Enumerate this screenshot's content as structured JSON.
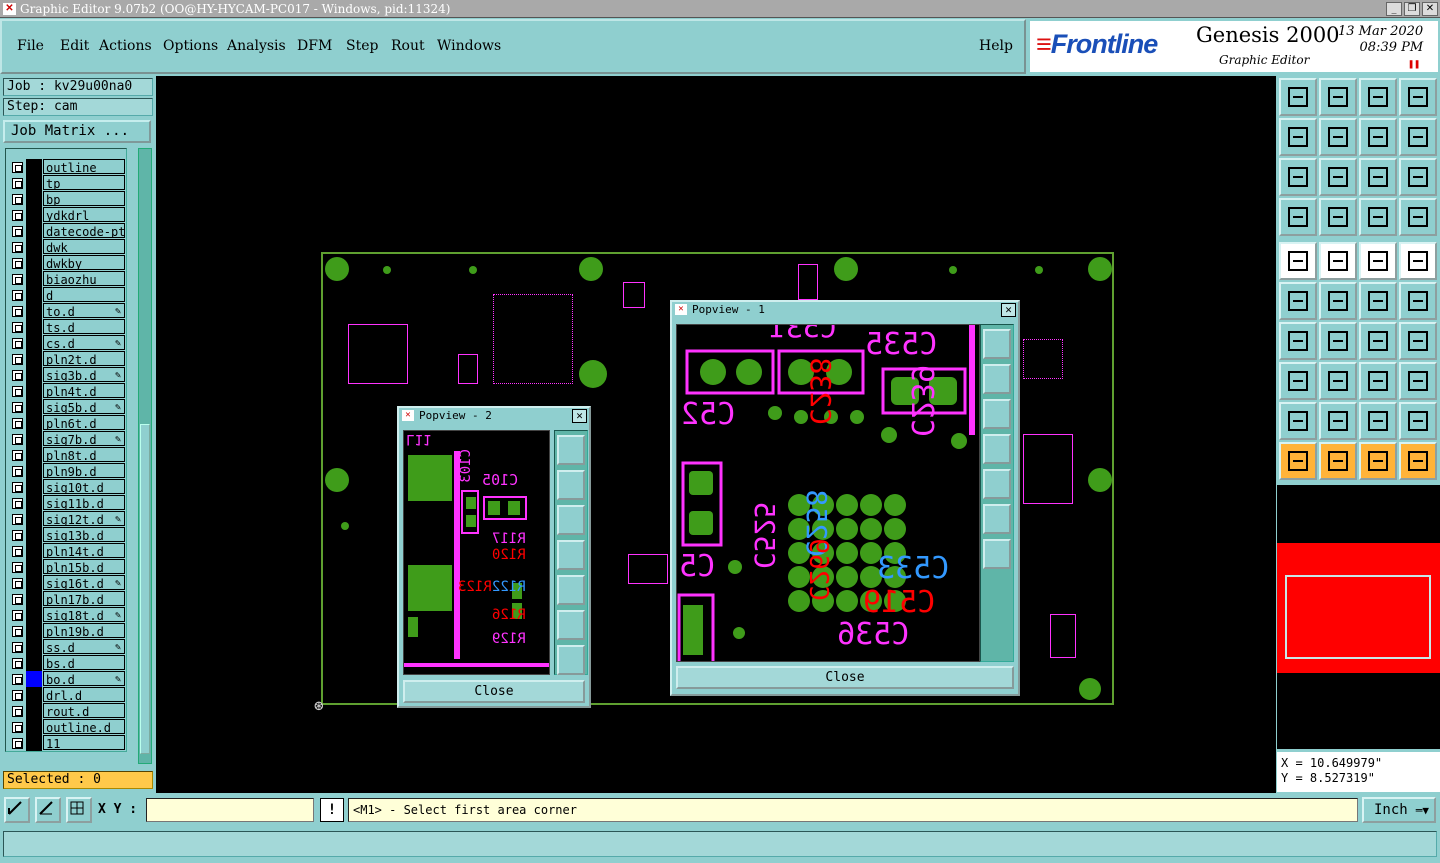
{
  "window": {
    "title": "Graphic Editor 9.07b2 (OO@HY-HYCAM-PC017 - Windows, pid:11324)"
  },
  "menu": {
    "file": "File",
    "edit": "Edit",
    "actions": "Actions",
    "options": "Options",
    "analysis": "Analysis",
    "dfm": "DFM",
    "step": "Step",
    "rout": "Rout",
    "windows": "Windows",
    "help": "Help"
  },
  "brand": {
    "logo": "Frontline",
    "product": "Genesis 2000",
    "subtitle": "Graphic Editor",
    "date": "13 Mar 2020",
    "time": "08:39 PM"
  },
  "job": {
    "job_label": "Job : kv29u00na0",
    "step_label": "Step: cam",
    "matrix_button": "Job Matrix ...",
    "selected": "Selected : 0"
  },
  "layers": [
    {
      "name": "outline"
    },
    {
      "name": "tp"
    },
    {
      "name": "bp"
    },
    {
      "name": "ydkdrl"
    },
    {
      "name": "datecode-ptc"
    },
    {
      "name": "dwk"
    },
    {
      "name": "dwkby"
    },
    {
      "name": "biaozhu"
    },
    {
      "name": "d"
    },
    {
      "name": "to.d",
      "affected": true
    },
    {
      "name": "ts.d"
    },
    {
      "name": "cs.d",
      "affected": true
    },
    {
      "name": "pln2t.d"
    },
    {
      "name": "sig3b.d",
      "affected": true
    },
    {
      "name": "pln4t.d"
    },
    {
      "name": "sig5b.d",
      "affected": true
    },
    {
      "name": "pln6t.d"
    },
    {
      "name": "sig7b.d",
      "affected": true
    },
    {
      "name": "pln8t.d"
    },
    {
      "name": "pln9b.d"
    },
    {
      "name": "sig10t.d"
    },
    {
      "name": "sig11b.d"
    },
    {
      "name": "sig12t.d",
      "affected": true
    },
    {
      "name": "sig13b.d"
    },
    {
      "name": "pln14t.d"
    },
    {
      "name": "pln15b.d"
    },
    {
      "name": "sig16t.d",
      "affected": true
    },
    {
      "name": "pln17b.d"
    },
    {
      "name": "sig18t.d",
      "affected": true
    },
    {
      "name": "pln19b.d"
    },
    {
      "name": "ss.d",
      "affected": true
    },
    {
      "name": "bs.d"
    },
    {
      "name": "bo.d",
      "affected": true,
      "color": "#0000ff"
    },
    {
      "name": "drl.d"
    },
    {
      "name": "rout.d"
    },
    {
      "name": "outline.d"
    },
    {
      "name": "11"
    }
  ],
  "popview1": {
    "title": "Popview - 1",
    "close": "Close",
    "labels": {
      "c531": "C531",
      "c535": "C535",
      "c52": "C52",
      "c238": "C238",
      "c239": "C239",
      "c533": "C533",
      "c519": "C519",
      "c536": "C536",
      "c5": "C5",
      "c525": "C525",
      "c258": "C258",
      "c269": "C269"
    }
  },
  "popview2": {
    "title": "Popview - 2",
    "close": "Close",
    "labels": {
      "l11": "L11",
      "c103": "C103",
      "c105": "C105",
      "r117": "R117",
      "r120": "R120",
      "r122": "R122",
      "r123": "R123",
      "r126": "R126",
      "r129": "R129"
    }
  },
  "coords": {
    "x": "X = 10.649979\"",
    "y": "Y = 8.527319\""
  },
  "bottom": {
    "xy_label": "X Y :",
    "xy_value": "",
    "excl": "!",
    "prompt": "<M1> - Select first area corner",
    "unit": "Inch"
  },
  "colors": {
    "background": "#8fcfcf",
    "canvas": "#000000",
    "pad": "#3f9c1a",
    "silk": "#ff33ff",
    "marker_red": "#ff0000",
    "marker_blue": "#3399ff"
  }
}
